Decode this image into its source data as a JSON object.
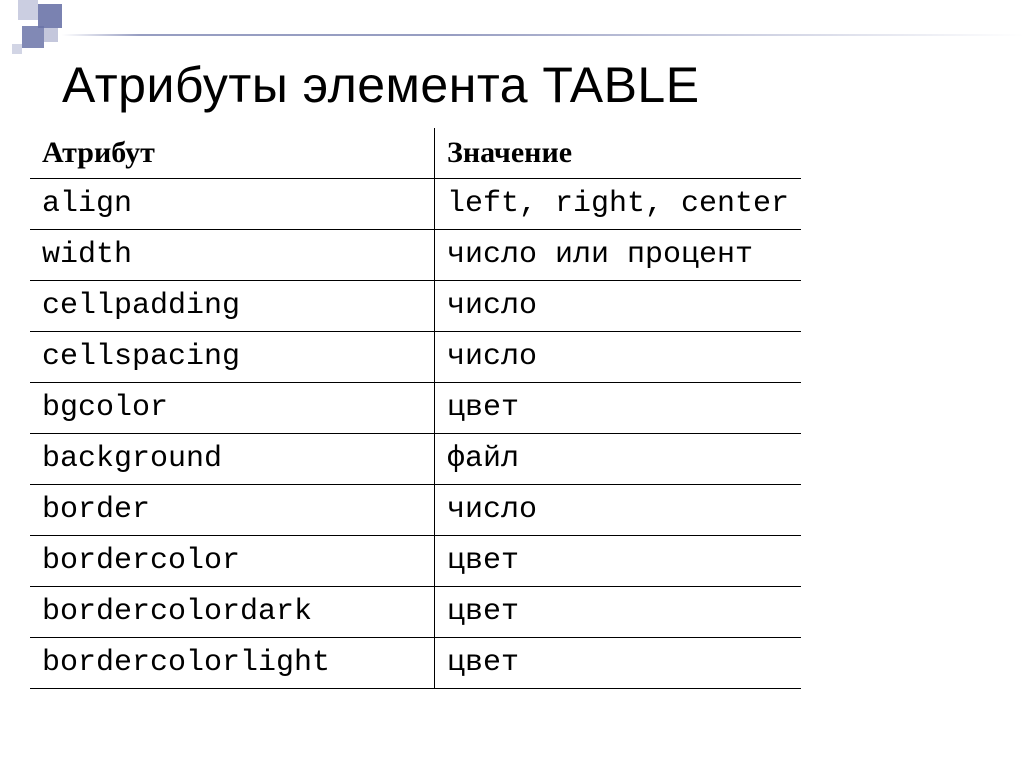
{
  "title": "Атрибуты элемента TABLE",
  "headers": {
    "attr": "Атрибут",
    "val": "Значение"
  },
  "rows": [
    {
      "attr": "align",
      "val": "left, right, center"
    },
    {
      "attr": "width",
      "val": "число или процент"
    },
    {
      "attr": "cellpadding",
      "val": "число"
    },
    {
      "attr": "cellspacing",
      "val": "число"
    },
    {
      "attr": "bgcolor",
      "val": "цвет"
    },
    {
      "attr": "background",
      "val": "файл"
    },
    {
      "attr": "border",
      "val": "число"
    },
    {
      "attr": "bordercolor",
      "val": "цвет"
    },
    {
      "attr": "bordercolordark",
      "val": "цвет"
    },
    {
      "attr": "bordercolorlight",
      "val": "цвет"
    }
  ]
}
